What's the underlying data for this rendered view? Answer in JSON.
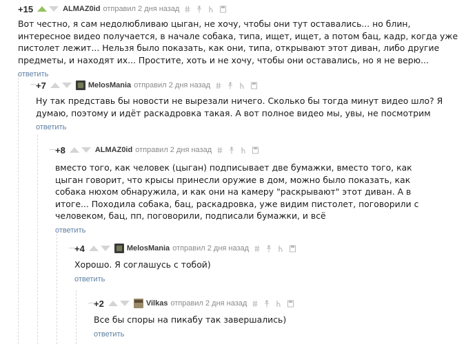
{
  "colors": {
    "accent": "#95c15f",
    "link": "#5c7fa3",
    "meta": "#8a8a8a"
  },
  "icons": [
    "hash-icon",
    "pin-icon",
    "share-icon",
    "save-icon"
  ],
  "comments": [
    {
      "rating": "+15",
      "author": "ALMAZ0id",
      "meta": "отправил 2 дня назад",
      "text": "Вот честно, я сам недолюбливаю цыган, не хочу, чтобы они тут оставались... но блин, интересное видео получается, в начале собака, типа, ищет, ищет, а потом бац, кадр, когда уже пистолет лежит... Нельзя было показать, как они, типа, открывают этот диван, либо другие предметы, и находят их... Простите, хоть и не хочу, чтобы они оставались, но я не верю...",
      "reply": "ответить"
    },
    {
      "rating": "+7",
      "author": "MelosMania",
      "meta": "отправил 2 дня назад",
      "text": "Ну так представь бы новости не вырезали ничего. Сколько бы тогда минут видео шло? Я думаю, поэтому и идёт раскадровка такая. А вот полное видео мы, увы, не посмотрим",
      "reply": "ответить"
    },
    {
      "rating": "+8",
      "author": "ALMAZ0id",
      "meta": "отправил 2 дня назад",
      "text": "вместо того, как человек (цыган) подписывает две бумажки, вместо того, как цыган говорит, что крысы принесли оружие в дом, можно было показать, как собака нюхом обнаружила, и как они на камеру \"раскрывают\" этот диван. А в итоге... Походила собака, бац, раскадровка, уже видим пистолет, поговорили с человеком, бац, пп, поговорили, подписали бумажки, и всё",
      "reply": "ответить"
    },
    {
      "rating": "+4",
      "author": "MelosMania",
      "meta": "отправил 2 дня назад",
      "text": "Хорошо. Я соглашусь с тобой)",
      "reply": "ответить"
    },
    {
      "rating": "+2",
      "author": "Vilkas",
      "meta": "отправил 2 дня назад",
      "text": "Все бы споры на пикабу так завершались)",
      "reply": "ответить"
    }
  ]
}
